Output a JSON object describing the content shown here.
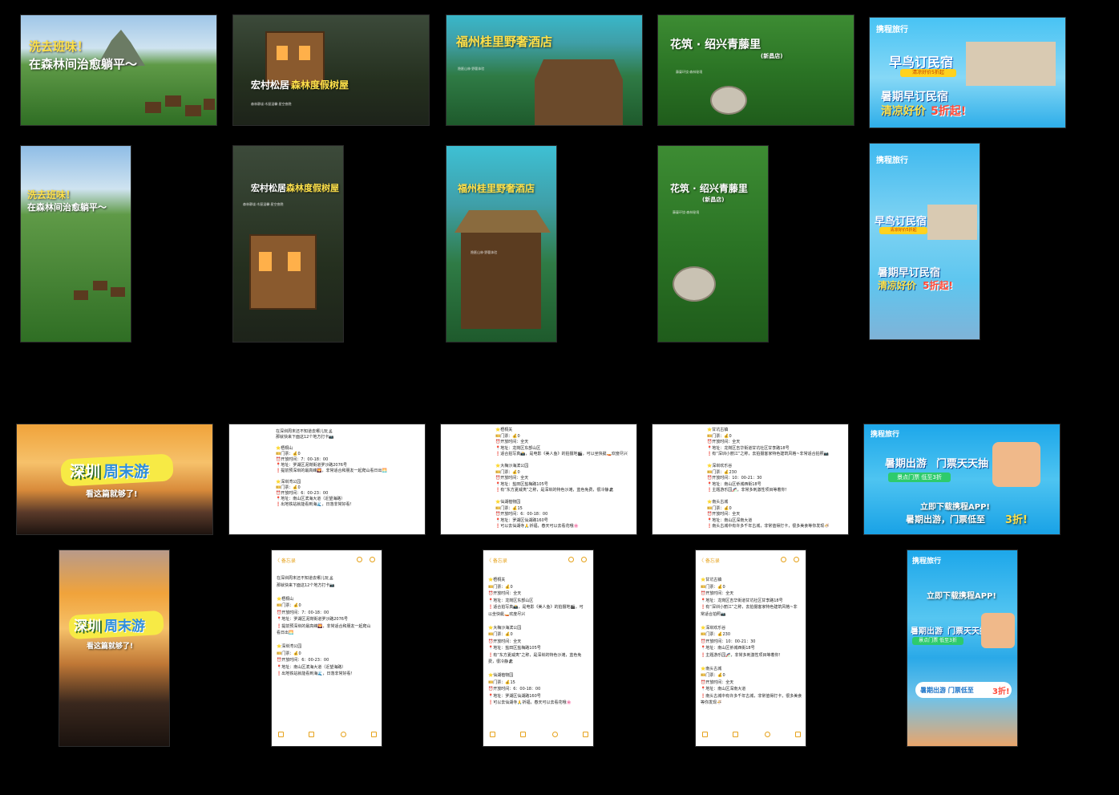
{
  "tiles": {
    "t1": {
      "line1": "洗去班味！",
      "line2": "在森林间治愈躺平～"
    },
    "t2": {
      "name_a": "宏村松居",
      "name_b": "森林度假树屋"
    },
    "t3": {
      "title": "福州桂里野奢酒店"
    },
    "t4": {
      "title": "花筑 · 绍兴青藤里",
      "sub": "(新昌店)"
    },
    "t5": {
      "brand": "携程旅行",
      "tag": "早鸟订民宿",
      "pill": "清凉好价5折起",
      "line1": "暑期早订民宿",
      "line2a": "清凉好价",
      "line2b": "5折起!"
    },
    "t6": {
      "line1": "洗去班味！",
      "line2": "在森林间治愈躺平～"
    },
    "t7": {
      "name_a": "宏村松居",
      "name_b": "森林度假树屋"
    },
    "t8": {
      "title": "福州桂里野奢酒店"
    },
    "t9": {
      "title": "花筑 · 绍兴青藤里",
      "sub": "(新昌店)"
    },
    "t10": {
      "brand": "携程旅行",
      "tag": "早鸟订民宿",
      "pill": "清凉好价5折起",
      "line1": "暑期早订民宿",
      "line2a": "清凉好价",
      "line2b": "5折起!"
    },
    "t11": {
      "title_a": "深圳",
      "title_b": "周末游",
      "sub": "看这篇就够了!"
    },
    "t12": {
      "lines": [
        "在深圳周末还不知道去哪儿玩🏝",
        "那就快来下面这12个地方打卡📷",
        "",
        "⭐梧桐山",
        "🎫门票：💰0",
        "⏰开放时间：7：00-18：00",
        "📍地址：罗湖区泥岗街道罗沙路2076号",
        "❗提前预深圳的最高峰🌄，非常适合和朋友一起爬山看日出🌅",
        "",
        "⭐深圳湾公园",
        "🎫门票：💰0",
        "⏰开放时间：6：00-23：00",
        "📍地址：南山区滨海大道（近望海路）",
        "❗出地铁站就能看到海🌊，日落非常好看！"
      ]
    },
    "t13": {
      "lines": [
        "⭐梧桐关",
        "🎫门票：💰0",
        "⏰开放时间：全天",
        "📍地址：龙岗区东部山区",
        "❗适合拍写真📸，是电影《美人鱼》的拍摄地🎬，可以坐快艇🚤欢度尽兴",
        "",
        "⭐大梅沙海滨公园",
        "🎫门票：💰0",
        "⏰开放时间：全天",
        "📍地址：盐田区盐梅路105号",
        "❗有“东方夏威夷”之称，是深圳的特色沙滩，蓝色免费，很冷静🏖",
        "",
        "⭐仙湖植物园",
        "🎫门票：💰15",
        "⏰开放时间：6：00-18：00",
        "📍地址：罗湖区仙湖路160号",
        "❗可以去仙湖寺🙏祈福，春天可以去看花哦🌸"
      ]
    },
    "t14": {
      "lines": [
        "⭐甘坑古镇",
        "🎫门票：💰0",
        "⏰开放时间：全天",
        "📍地址：龙岗区吉华街道甘坑社区甘李路18号",
        "❗有“深圳小丽江”之称，去拍摄客家特色建筑风格~非常适合拍照📷",
        "",
        "⭐深圳欢乐谷",
        "🎫门票：💰230",
        "⏰开放时间：10：00-21：30",
        "📍地址：南山区侨城西街18号",
        "❗主题游乐园🎢，非常多刺激性项目等着你！",
        "",
        "⭐南头古城",
        "🎫门票：💰0",
        "⏰开放时间：全天",
        "📍地址：南山区深南大道",
        "❗南头古城中有许多千年古城，非常值得打卡，很多美食等你发现🍜"
      ]
    },
    "t15": {
      "brand": "携程旅行",
      "line1a": "暑期出游",
      "line1b": "门票天天抽",
      "pill": "景点门票 低至3折",
      "dl1": "立即下载携程APP!",
      "dl2a": "暑期出游，门票低至",
      "dl2b": "3折!"
    },
    "t16": {
      "title_a": "深圳",
      "title_b": "周末游",
      "sub": "看这篇就够了!"
    },
    "t17": {
      "back": "〈 备忘录",
      "lines": [
        "在深圳周末还不知道去哪儿玩🏝",
        "那就快来下面这12个地方打卡📷",
        "",
        "⭐梧桐山",
        "🎫门票：💰0",
        "⏰开放时间：7：00-18：00",
        "📍地址：罗湖区泥岗街道罗沙路2076号",
        "❗提前预深圳的最高峰🌄，非常适合和朋友一起爬山",
        "看日出🌅",
        "",
        "⭐深圳湾公园",
        "🎫门票：💰0",
        "⏰开放时间：6：00-23：00",
        "📍地址：南山区滨海大道（近望海路）",
        "❗出地铁站就能看到海🌊，日落非常好看！"
      ]
    },
    "t18": {
      "back": "〈 备忘录",
      "lines": [
        "⭐梧桐关",
        "🎫门票：💰0",
        "⏰开放时间：全天",
        "📍地址：龙岗区东部山区",
        "❗适合拍写真📸，是电影《美人鱼》的拍摄地🎬，可",
        "以坐快艇🚤欢度尽兴",
        "",
        "⭐大梅沙海滨公园",
        "🎫门票：💰0",
        "⏰开放时间：全天",
        "📍地址：盐田区盐梅路105号",
        "❗有“东方夏威夷”之称，是深圳的特色沙滩，蓝色免",
        "费，很冷静🏖",
        "",
        "⭐仙湖植物园",
        "🎫门票：💰15",
        "⏰开放时间：6：00-18：00",
        "📍地址：罗湖区仙湖路160号",
        "❗可以去仙湖寺🙏祈福，春天可以去看花哦🌸"
      ]
    },
    "t19": {
      "back": "〈 备忘录",
      "lines": [
        "⭐甘坑古镇",
        "🎫门票：💰0",
        "⏰开放时间：全天",
        "📍地址：龙岗区吉华街道甘坑社区甘李路18号",
        "❗有“深圳小丽江”之称，去拍摄客家特色建筑风格~非",
        "常适合拍照📷",
        "",
        "⭐深圳欢乐谷",
        "🎫门票：💰230",
        "⏰开放时间：10：00-21：30",
        "📍地址：南山区侨城西街18号",
        "❗主题游乐园🎢，非常多刺激性项目等着你！",
        "",
        "⭐南头古城",
        "🎫门票：💰0",
        "⏰开放时间：全天",
        "📍地址：南山区深南大道",
        "❗南头古城中有许多千年古城，非常值得打卡，很多美食",
        "等你发现🍜"
      ]
    },
    "t20": {
      "brand": "携程旅行",
      "dl1": "立即下载携程APP!",
      "line1a": "暑期出游",
      "line1b": "门票天天抽",
      "pill": "景点门票 低至3折",
      "dl2a": "暑期出游 门票低至",
      "dl2b": "3折!"
    }
  },
  "colors": {
    "accent_yellow": "#ffe14a",
    "ctrip_blue": "#1fa3e8",
    "note_orange": "#e6a21b",
    "forest": "#2d7a2a",
    "sunset": "#e79a3c"
  }
}
